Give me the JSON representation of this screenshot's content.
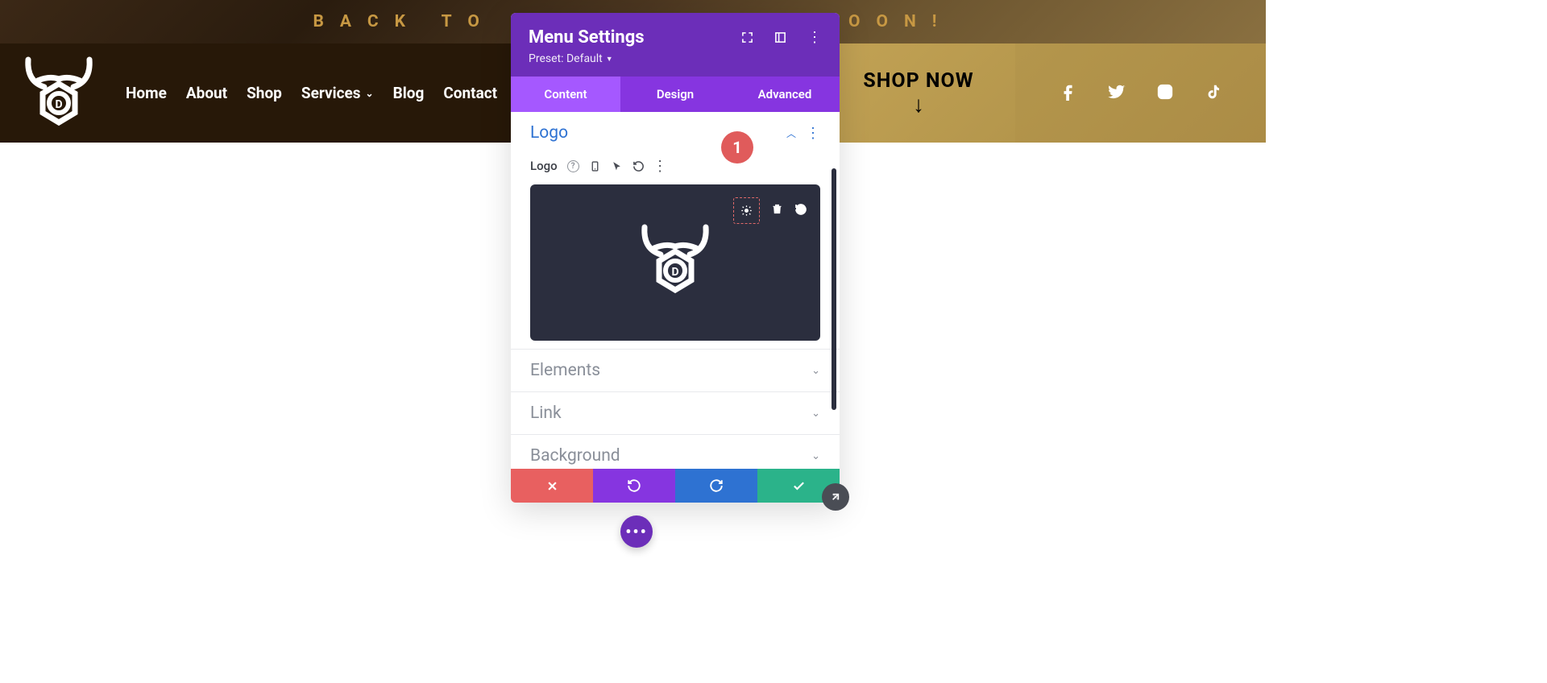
{
  "banner_text": "BACK TO S",
  "banner_text_right": "OON!",
  "nav": {
    "items": [
      "Home",
      "About",
      "Shop",
      "Services",
      "Blog",
      "Contact"
    ],
    "shop_now": "SHOP NOW"
  },
  "modal": {
    "title": "Menu Settings",
    "preset_label": "Preset: Default",
    "tabs": [
      "Content",
      "Design",
      "Advanced"
    ],
    "section_open": "Logo",
    "logo_field_label": "Logo",
    "sections_closed": [
      "Elements",
      "Link",
      "Background"
    ]
  },
  "badge": "1"
}
